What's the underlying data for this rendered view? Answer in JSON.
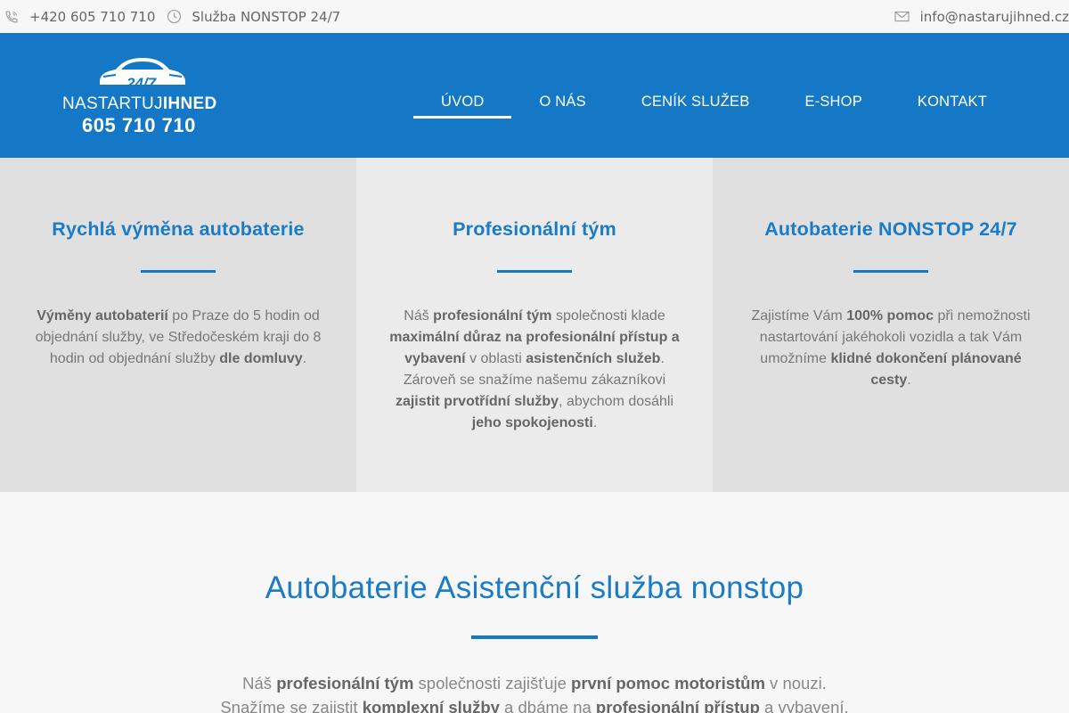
{
  "topbar": {
    "phone": "+420 605 710 710",
    "service": "Služba NONSTOP 24/7",
    "email": "info@nastarujihned.cz"
  },
  "logo": {
    "badge": "24/7",
    "brand_light": "NASTARTUJ",
    "brand_bold": "IHNED",
    "phone": "605 710 710"
  },
  "nav": {
    "items": [
      {
        "label": "ÚVOD",
        "active": true
      },
      {
        "label": "O NÁS"
      },
      {
        "label": "CENÍK SLUŽEB"
      },
      {
        "label": "E-SHOP"
      },
      {
        "label": "KONTAKT"
      }
    ]
  },
  "features": [
    {
      "title": "Rychlá výměna autobaterie",
      "text": [
        {
          "b": "Výměny autobaterií"
        },
        {
          "t": " po Praze do 5 hodin od objednání služby, ve Středočeském kraji do 8 hodin od objednání služby "
        },
        {
          "b": "dle domluvy"
        },
        {
          "t": "."
        }
      ]
    },
    {
      "title": "Profesionální tým",
      "text": [
        {
          "t": "Náš "
        },
        {
          "b": "profesionální tým"
        },
        {
          "t": " společnosti klade "
        },
        {
          "b": "maximální důraz na profesionální přístup a vybavení"
        },
        {
          "t": " v oblasti "
        },
        {
          "b": "asistenčních služeb"
        },
        {
          "t": ". Zároveň se snažíme našemu zákazníkovi "
        },
        {
          "b": "zajistit prvotřídní služby"
        },
        {
          "t": ", abychom dosáhli "
        },
        {
          "b": "jeho spokojenosti"
        },
        {
          "t": "."
        }
      ]
    },
    {
      "title": "Autobaterie NONSTOP 24/7",
      "text": [
        {
          "t": "Zajistíme Vám "
        },
        {
          "b": "100% pomoc"
        },
        {
          "t": " při nemožnosti nastartování jakéhokoli vozidla a tak Vám umožníme "
        },
        {
          "b": "klidné dokončení plánované cesty"
        },
        {
          "t": "."
        }
      ]
    }
  ],
  "section2": {
    "title": "Autobaterie Asistenční služba nonstop",
    "lines": [
      [
        {
          "t": "Náš "
        },
        {
          "b": "profesionální tým"
        },
        {
          "t": " společnosti zajišťuje "
        },
        {
          "b": "první pomoc motoristům"
        },
        {
          "t": " v nouzi."
        }
      ],
      [
        {
          "t": "Snažíme se zajistit "
        },
        {
          "b": "komplexní služby"
        },
        {
          "t": " a dbáme na "
        },
        {
          "b": "profesionální přístup"
        },
        {
          "t": " a vybavení."
        }
      ]
    ]
  },
  "colors": {
    "brand_blue": "#1478c6",
    "heading_blue": "#1a7bc6"
  },
  "icons": {
    "phone": "phone-icon",
    "clock": "clock-icon",
    "mail": "mail-icon",
    "car": "car-icon"
  }
}
